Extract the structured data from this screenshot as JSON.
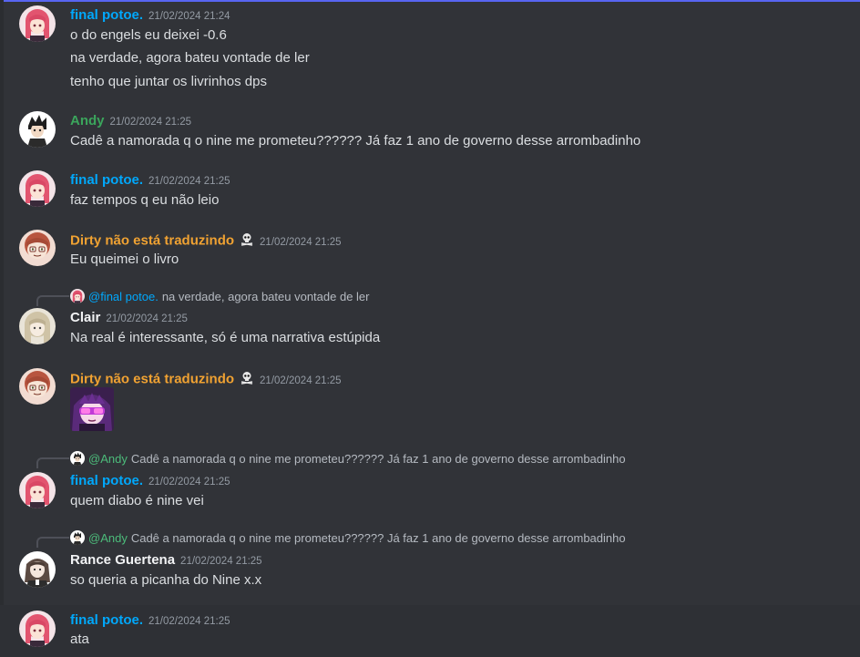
{
  "colors": {
    "background": "#313338",
    "name_blue": "#00a8fc",
    "name_green": "#3ba55c",
    "name_orange": "#f0a232",
    "name_white": "#f2f3f5",
    "mention_andy": "#4cbb7a",
    "mention_potoe": "#00a8fc"
  },
  "messages": [
    {
      "author": "final potoe.",
      "timestamp": "21/02/2024 21:24",
      "lines": [
        "o do engels eu deixei -0.6",
        "na verdade, agora bateu vontade de ler",
        "tenho que juntar os livrinhos dps"
      ]
    },
    {
      "author": "Andy",
      "timestamp": "21/02/2024 21:25",
      "lines": [
        "Cadê a namorada q o nine me prometeu?????? Já faz 1 ano de governo desse arrombadinho"
      ]
    },
    {
      "author": "final potoe.",
      "timestamp": "21/02/2024 21:25",
      "lines": [
        "faz tempos q eu não leio"
      ]
    },
    {
      "author": "Dirty não está traduzindo",
      "badge_icon": "skull-crossbones-icon",
      "timestamp": "21/02/2024 21:25",
      "lines": [
        "Eu queimei o livro"
      ]
    },
    {
      "reply": {
        "mention": "@final potoe.",
        "text": "na verdade, agora bateu vontade de ler"
      },
      "author": "Clair",
      "timestamp": "21/02/2024 21:25",
      "lines": [
        "Na real é interessante, só é uma narrativa estúpida"
      ]
    },
    {
      "author": "Dirty não está traduzindo",
      "badge_icon": "skull-crossbones-icon",
      "timestamp": "21/02/2024 21:25",
      "sticker": "anime-sunglasses-sticker"
    },
    {
      "reply": {
        "mention": "@Andy",
        "text": "Cadê a namorada q o nine me prometeu?????? Já faz 1 ano de governo desse arrombadinho"
      },
      "author": "final potoe.",
      "timestamp": "21/02/2024 21:25",
      "lines": [
        "quem diabo é nine vei"
      ]
    },
    {
      "reply": {
        "mention": "@Andy",
        "text": "Cadê a namorada q o nine me prometeu?????? Já faz 1 ano de governo desse arrombadinho"
      },
      "author": "Rance Guertena",
      "timestamp": "21/02/2024 21:25",
      "lines": [
        "so queria a picanha do Nine x.x"
      ]
    },
    {
      "author": "final potoe.",
      "timestamp": "21/02/2024 21:25",
      "lines": [
        "ata"
      ]
    }
  ]
}
